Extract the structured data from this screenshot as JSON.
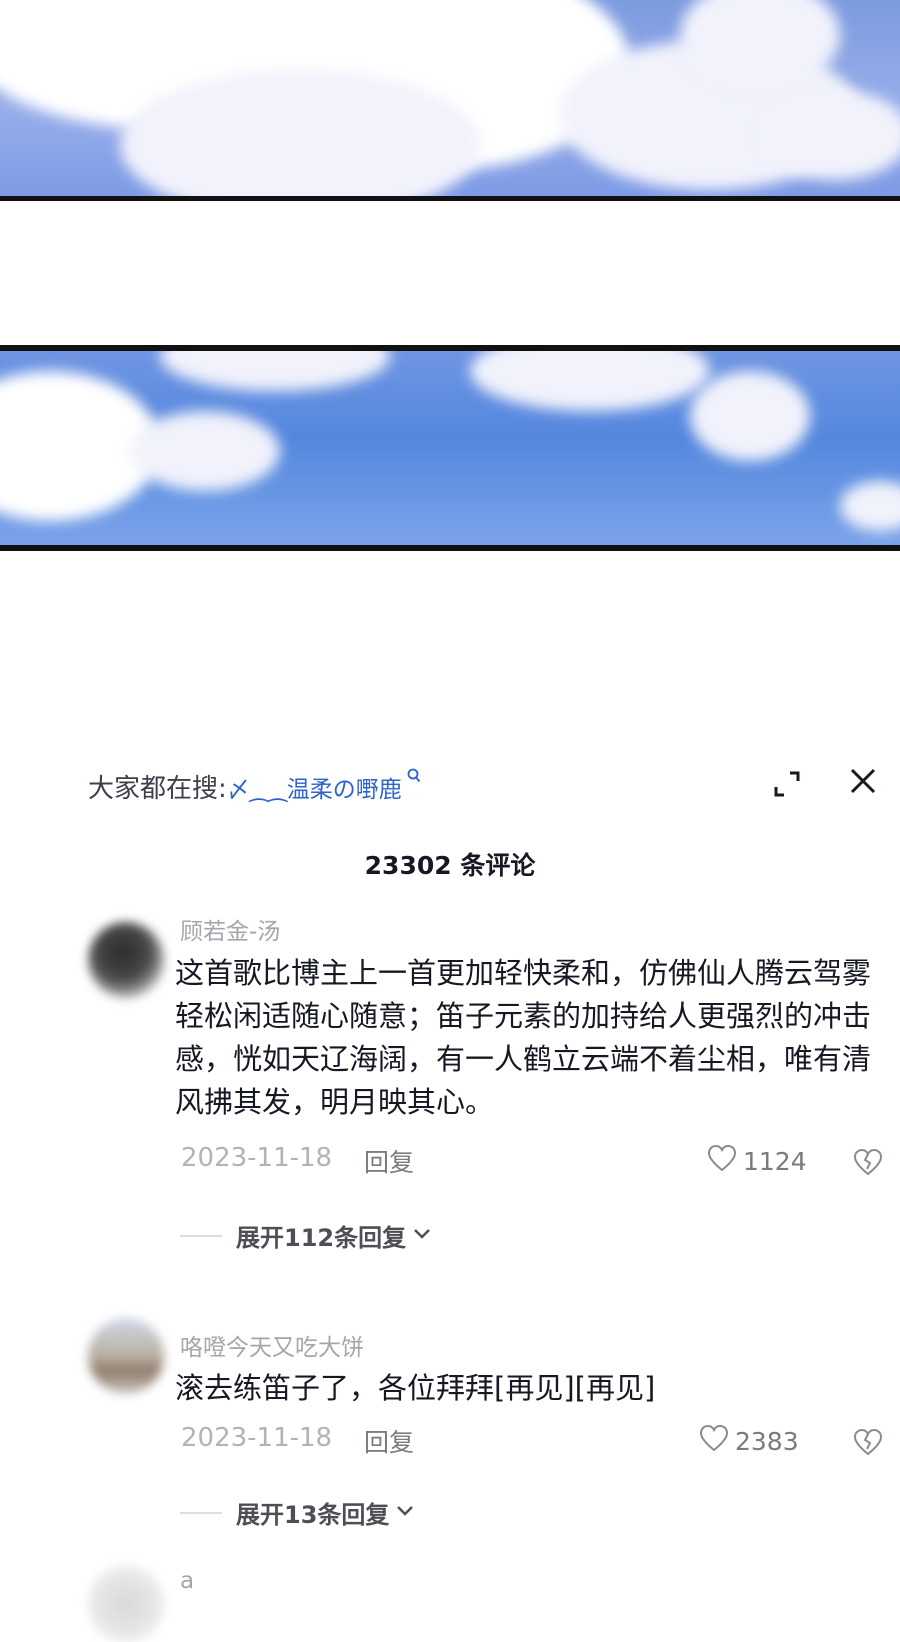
{
  "search": {
    "prefix": "大家都在搜:",
    "keyword": "〆⁔⁔温柔の嘢鹿"
  },
  "comments_header": {
    "count_label": "23302 条评论"
  },
  "comments": [
    {
      "nickname": "顾若金-汤",
      "text": "这首歌比博主上一首更加轻快柔和，仿佛仙人腾云驾雾轻松闲适随心随意；笛子元素的加持给人更强烈的冲击感，恍如天辽海阔，有一人鹤立云端不着尘相，唯有清风拂其发，明月映其心。",
      "date": "2023-11-18",
      "reply_label": "回复",
      "likes": "1124",
      "expand_label": "展开112条回复"
    },
    {
      "nickname": "咯噔今天又吃大饼",
      "text": "滚去练笛子了，各位拜拜[再见][再见]",
      "date": "2023-11-18",
      "reply_label": "回复",
      "likes": "2383",
      "expand_label": "展开13条回复"
    },
    {
      "nickname": "a"
    }
  ],
  "icons": {
    "expand": "expand-icon",
    "close": "close-icon",
    "search": "search-icon",
    "like": "heart-icon",
    "dislike": "broken-heart-icon",
    "chevron": "chevron-down-icon"
  }
}
